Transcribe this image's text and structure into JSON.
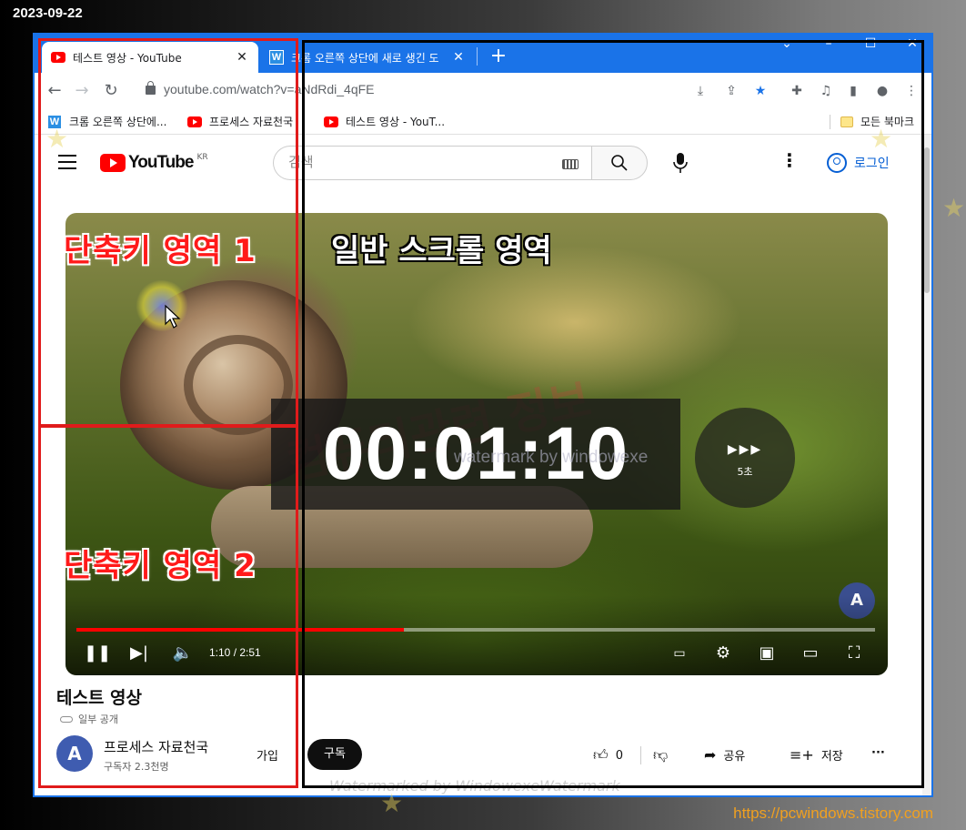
{
  "capture": {
    "date": "2023-09-22",
    "site": "https://pcwindows.tistory.com"
  },
  "browser": {
    "tabs": [
      {
        "title": "테스트 영상 - YouTube",
        "active": true,
        "icon": "youtube-favicon"
      },
      {
        "title": "크롬 오른쪽 상단에 새로 생긴 도",
        "active": false,
        "icon": "w-favicon"
      }
    ],
    "close_glyph": "✕",
    "new_tab_glyph": "+",
    "url": "youtube.com/watch?v=aNdRdi_4qFE",
    "bookmarks": [
      {
        "label": "크롬 오른쪽 상단에...",
        "icon": "w-favicon"
      },
      {
        "label": "프로세스 자료천국",
        "icon": "youtube-favicon"
      },
      {
        "label": "테스트 영상 - YouT...",
        "icon": "youtube-favicon"
      }
    ],
    "all_bookmarks": "모든 북마크"
  },
  "youtube": {
    "logo": "YouTube",
    "region": "KR",
    "search_placeholder": "검색",
    "signin": "로그인",
    "video": {
      "timer": "00:01:10",
      "seek_label": "5초",
      "watermark": "watermark by windowexe",
      "watermark_big": "컴퓨터관련 정보",
      "time_display": "1:10 / 2:51",
      "progress": 0.41,
      "channel_badge": "A"
    },
    "title": "테스트 영상",
    "visibility": "일부 공개",
    "channel": {
      "name": "프로세스 자료천국",
      "subscribers": "구독자 2.3천명",
      "avatar": "A"
    },
    "join": "가입",
    "subscribe": "구독",
    "likes": "0",
    "share": "공유",
    "save": "저장",
    "bottom_watermark": "Watermarked by WindowexeWatermark"
  },
  "annotations": {
    "zone1": "단축키 영역 1",
    "zone2": "단축키 영역 2",
    "scroll_zone": "일반 스크롤 영역"
  },
  "colors": {
    "chrome_blue": "#1a73e8",
    "youtube_red": "#ff0000",
    "annotation_red": "#e01b1b"
  }
}
